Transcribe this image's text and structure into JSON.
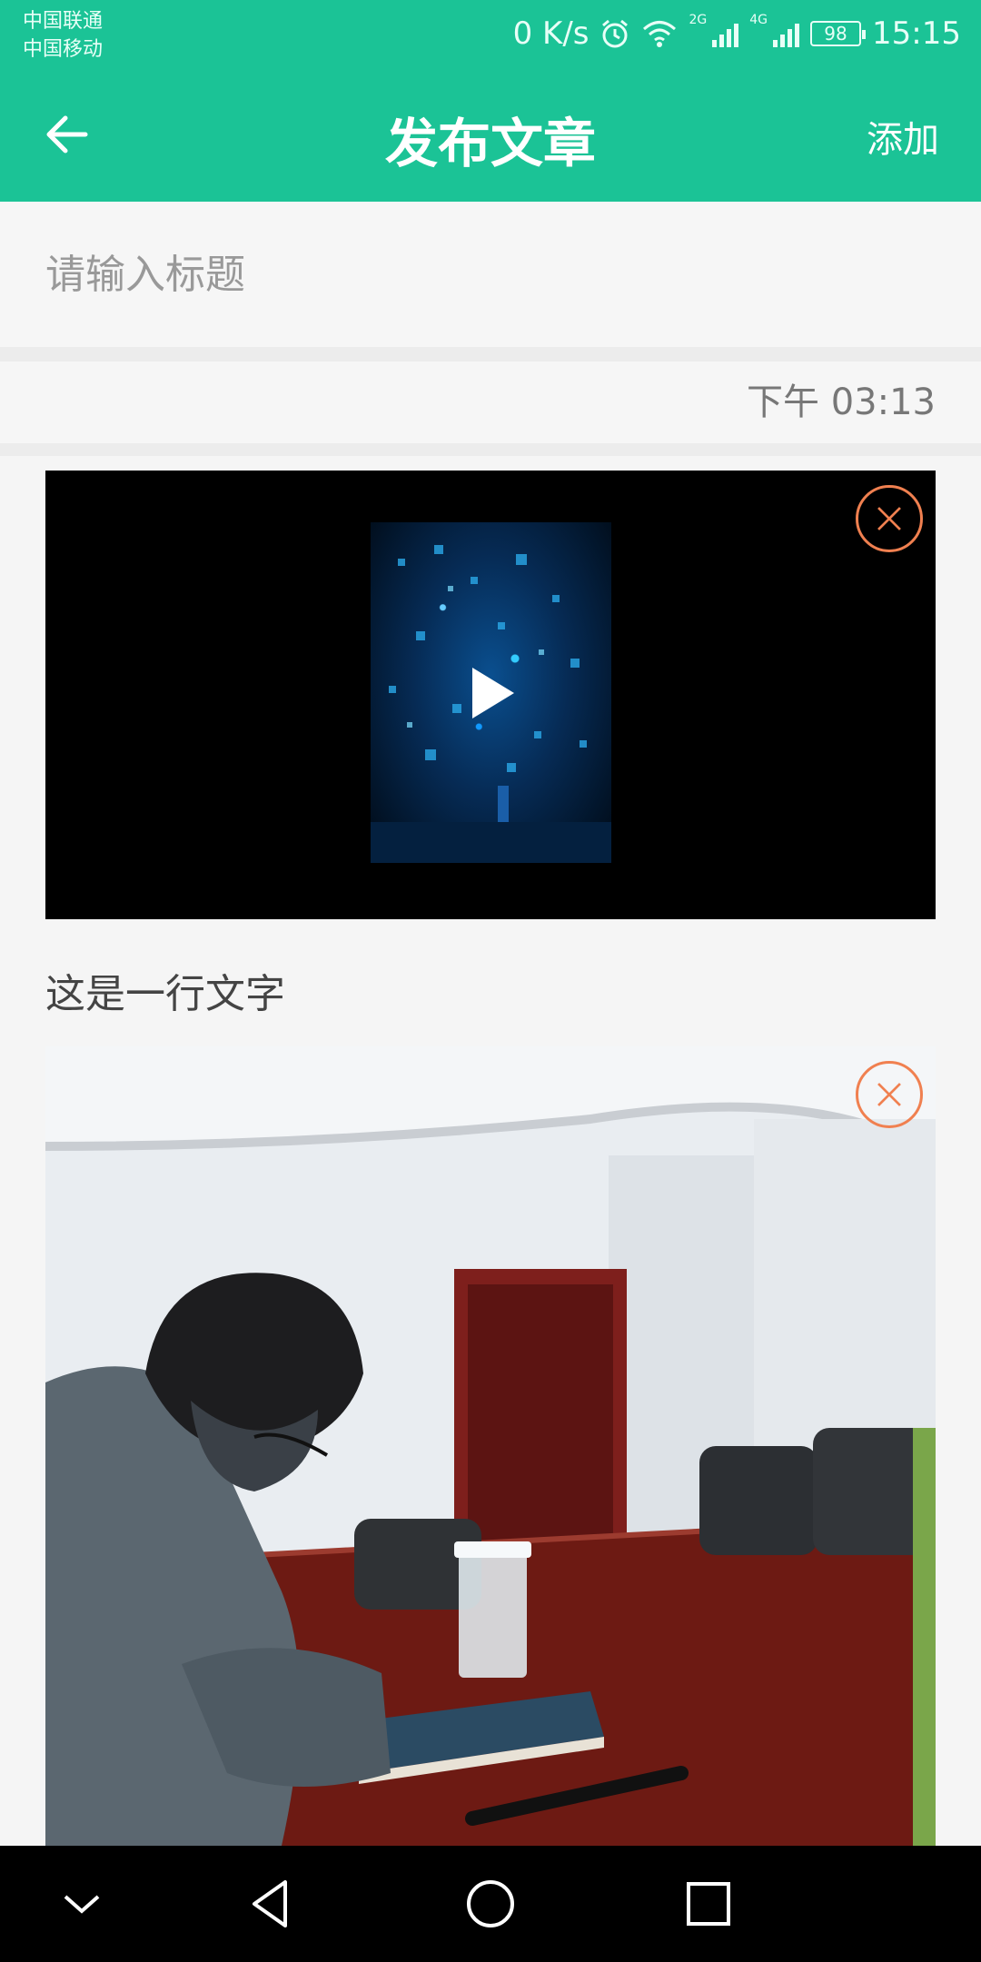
{
  "status_bar": {
    "carrier_1": "中国联通",
    "carrier_2": "中国移动",
    "net_speed": "0 K/s",
    "sig_2g": "2G",
    "sig_4g": "4G",
    "battery": "98",
    "time": "15:15"
  },
  "toolbar": {
    "title": "发布文章",
    "add_label": "添加"
  },
  "editor": {
    "title_placeholder": "请输入标题",
    "time": "下午 03:13",
    "text_line": "这是一行文字"
  },
  "colors": {
    "brand": "#1bc396",
    "close": "#f08050"
  }
}
